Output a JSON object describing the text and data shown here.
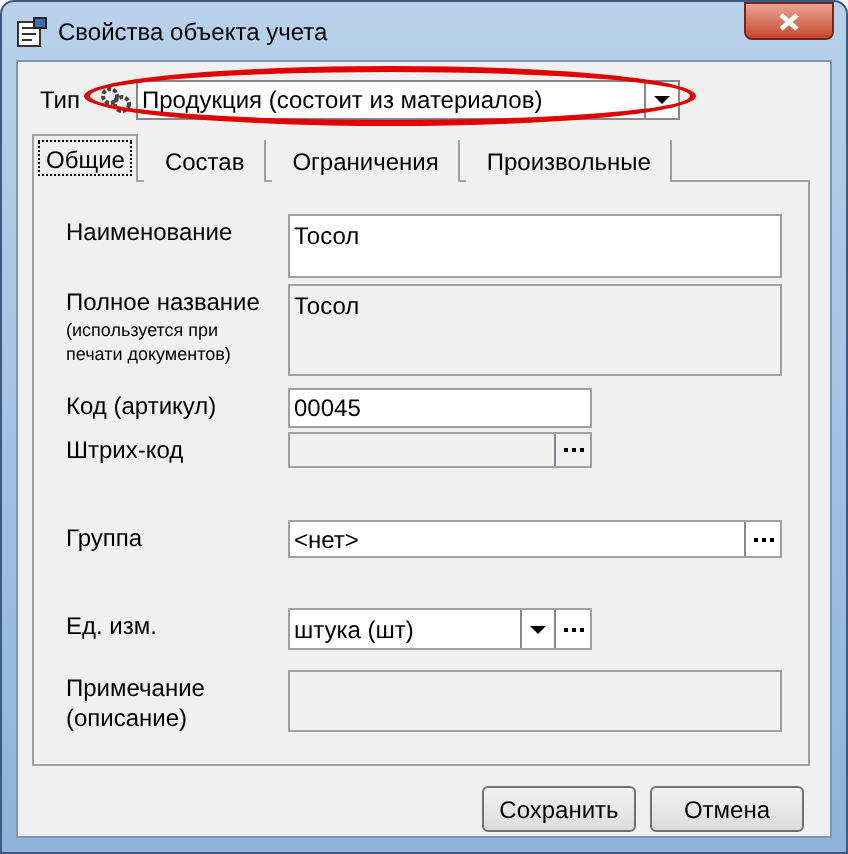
{
  "window": {
    "title": "Свойства объекта учета"
  },
  "type_field": {
    "label": "Тип",
    "value": "Продукция (состоит из материалов)",
    "highlighted": true
  },
  "tabs": [
    {
      "label": "Общие",
      "selected": true
    },
    {
      "label": "Состав",
      "selected": false
    },
    {
      "label": "Ограничения",
      "selected": false
    },
    {
      "label": "Произвольные",
      "selected": false
    }
  ],
  "fields": [
    {
      "label": "Наименование",
      "kind": "multiline",
      "value": "Тосол",
      "disabled": false
    },
    {
      "label": "Полное название",
      "note": "(используется при печати документов)",
      "kind": "multiline",
      "value": "Тосол",
      "disabled": true
    },
    {
      "label": "Код (артикул)",
      "kind": "text",
      "value": "00045",
      "disabled": false
    },
    {
      "label": "Штрих-код",
      "kind": "lookup",
      "disabled": true
    },
    {
      "label": "Группа",
      "kind": "lookup",
      "value": "<нет>",
      "disabled": false
    },
    {
      "label": "Ед. изм.",
      "kind": "combo",
      "value": "штука (шт)",
      "disabled": false
    },
    {
      "label": "Примечание (описание)",
      "kind": "multiline",
      "disabled": true
    }
  ],
  "buttons": [
    "Сохранить",
    "Отмена"
  ]
}
